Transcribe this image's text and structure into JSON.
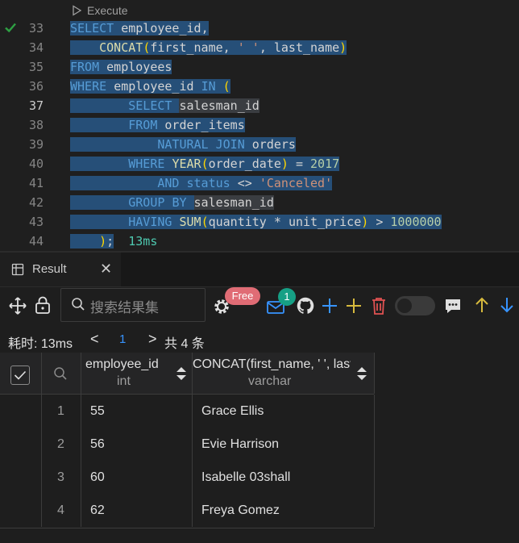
{
  "editor": {
    "codelens": "Execute",
    "lines": [
      {
        "num": "33",
        "check": true
      },
      {
        "num": "34"
      },
      {
        "num": "35"
      },
      {
        "num": "36"
      },
      {
        "num": "37",
        "active": true
      },
      {
        "num": "38"
      },
      {
        "num": "39"
      },
      {
        "num": "40"
      },
      {
        "num": "41"
      },
      {
        "num": "42"
      },
      {
        "num": "43"
      },
      {
        "num": "44"
      }
    ],
    "tokens": {
      "select": "SELECT",
      "employee_id": "employee_id",
      "comma": ",",
      "concat": "CONCAT",
      "first_name": "first_name",
      "space_str": "' '",
      "last_name": "last_name",
      "from": "FROM",
      "employees": "employees",
      "where": "WHERE",
      "in": "IN",
      "salesman_id": "salesman_id",
      "order_items": "order_items",
      "natural": "NATURAL",
      "join": "JOIN",
      "orders": "orders",
      "year": "YEAR",
      "order_date": "order_date",
      "eq": "=",
      "year_val": "2017",
      "and": "AND",
      "status": "status",
      "neq": "<>",
      "canceled": "'Canceled'",
      "group": "GROUP",
      "by": "BY",
      "having": "HAVING",
      "sum": "SUM",
      "quantity": "quantity",
      "times": "*",
      "unit_price": "unit_price",
      "gt": ">",
      "million": "1000000",
      "close_paren": ")",
      "semicolon": ";",
      "open_paren": "(",
      "timing": "13ms"
    }
  },
  "panel": {
    "tab_label": "Result",
    "close_glyph": "✕"
  },
  "toolbar": {
    "search_placeholder": "搜索结果集",
    "free_badge": "Free",
    "mail_count": "1"
  },
  "pager": {
    "elapsed": "耗时: 13ms",
    "prev": "<",
    "current_page": "1",
    "next": ">",
    "total": "共 4 条"
  },
  "table": {
    "columns": [
      {
        "name": "employee_id",
        "type": "int"
      },
      {
        "name": "CONCAT(first_name, ' ', last_name)",
        "type": "varchar"
      }
    ],
    "rows": [
      {
        "n": "1",
        "employee_id": "55",
        "full_name": "Grace Ellis"
      },
      {
        "n": "2",
        "employee_id": "56",
        "full_name": "Evie Harrison"
      },
      {
        "n": "3",
        "employee_id": "60",
        "full_name": "Isabelle 03shall"
      },
      {
        "n": "4",
        "employee_id": "62",
        "full_name": "Freya Gomez"
      }
    ]
  },
  "colors": {
    "selection": "#264f78",
    "keyword": "#569cd6",
    "function": "#dcdcaa",
    "string": "#ce9178",
    "number": "#b5cea8",
    "accent_blue": "#3794ff",
    "success_green": "#4ec9b0"
  }
}
